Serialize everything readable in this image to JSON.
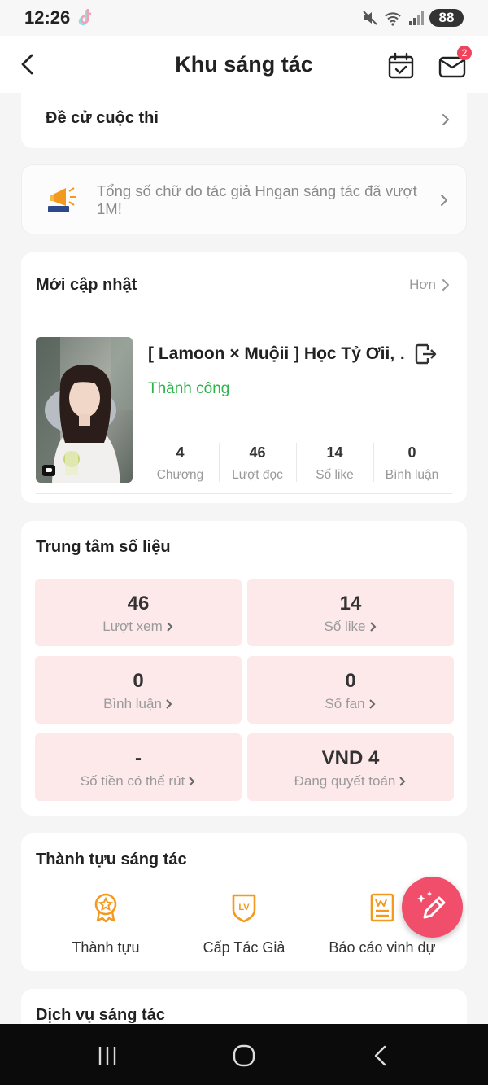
{
  "status_bar": {
    "time": "12:26",
    "battery": "88",
    "icons": [
      "tiktok-icon",
      "mute-icon",
      "wifi-icon",
      "signal-icon"
    ]
  },
  "header": {
    "title": "Khu sáng tác",
    "mail_badge": "2",
    "icons": [
      "back-arrow-icon",
      "calendar-check-icon",
      "mail-icon"
    ]
  },
  "nominate": {
    "label": "Đề cử cuộc thi"
  },
  "notice": {
    "text": "Tổng số chữ do tác giả Hngan  sáng tác đã vượt 1M!",
    "icon": "megaphone-icon"
  },
  "recent": {
    "title": "Mới cập nhật",
    "more": "Hơn",
    "story": {
      "title": "[ Lamoon × Muộii ] Học Tỷ Ơii, ",
      "status": "Thành công",
      "stats": [
        {
          "value": "4",
          "label": "Chương"
        },
        {
          "value": "46",
          "label": "Lượt đọc"
        },
        {
          "value": "14",
          "label": "Số like"
        },
        {
          "value": "0",
          "label": "Bình luận"
        }
      ]
    }
  },
  "data_center": {
    "title": "Trung tâm số liệu",
    "tiles": [
      {
        "value": "46",
        "label": "Lượt xem"
      },
      {
        "value": "14",
        "label": "Số like"
      },
      {
        "value": "0",
        "label": "Bình luận"
      },
      {
        "value": "0",
        "label": "Số fan"
      },
      {
        "value": "-",
        "label": "Số tiền có thể rút"
      },
      {
        "value": "VND 4",
        "label": "Đang quyết toán"
      }
    ]
  },
  "achievements": {
    "title": "Thành tựu sáng tác",
    "items": [
      {
        "label": "Thành tựu",
        "icon": "medal-icon"
      },
      {
        "label": "Cấp Tác Giả",
        "icon": "level-shield-icon"
      },
      {
        "label": "Báo cáo vinh dự",
        "icon": "honor-report-icon"
      }
    ]
  },
  "services": {
    "title": "Dịch vụ sáng tác"
  },
  "colors": {
    "accent": "#f04e6a",
    "success": "#2fb24c",
    "tile_bg": "#fde8ea",
    "icon_orange": "#f39a1e"
  }
}
